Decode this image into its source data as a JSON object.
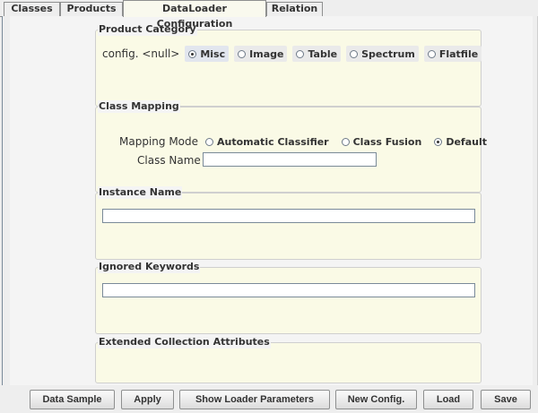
{
  "tabs": [
    {
      "label": "Classes"
    },
    {
      "label": "Products"
    },
    {
      "label": "DataLoader Configuration",
      "active": true
    },
    {
      "label": "Relation"
    }
  ],
  "product_category": {
    "title": "Product Category",
    "label": "config. <null>",
    "options": [
      "Misc",
      "Image",
      "Table",
      "Spectrum",
      "Flatfile"
    ],
    "selected": "Misc"
  },
  "class_mapping": {
    "title": "Class Mapping",
    "mode_label": "Mapping Mode",
    "options": [
      "Automatic Classifier",
      "Class Fusion",
      "Default"
    ],
    "selected": "Default",
    "class_name_label": "Class Name",
    "class_name_value": ""
  },
  "instance_name": {
    "title": "Instance Name",
    "value": ""
  },
  "ignored_keywords": {
    "title": "Ignored Keywords",
    "value": ""
  },
  "extended_collection_attributes": {
    "title": "Extended Collection Attributes"
  },
  "buttons": [
    "Data Sample",
    "Apply",
    "Show Loader Parameters",
    "New Config.",
    "Load",
    "Save"
  ],
  "colors": {
    "panel_bg": "#fafae6",
    "window_bg": "#eeeeee",
    "border": "#8e8f8f"
  }
}
